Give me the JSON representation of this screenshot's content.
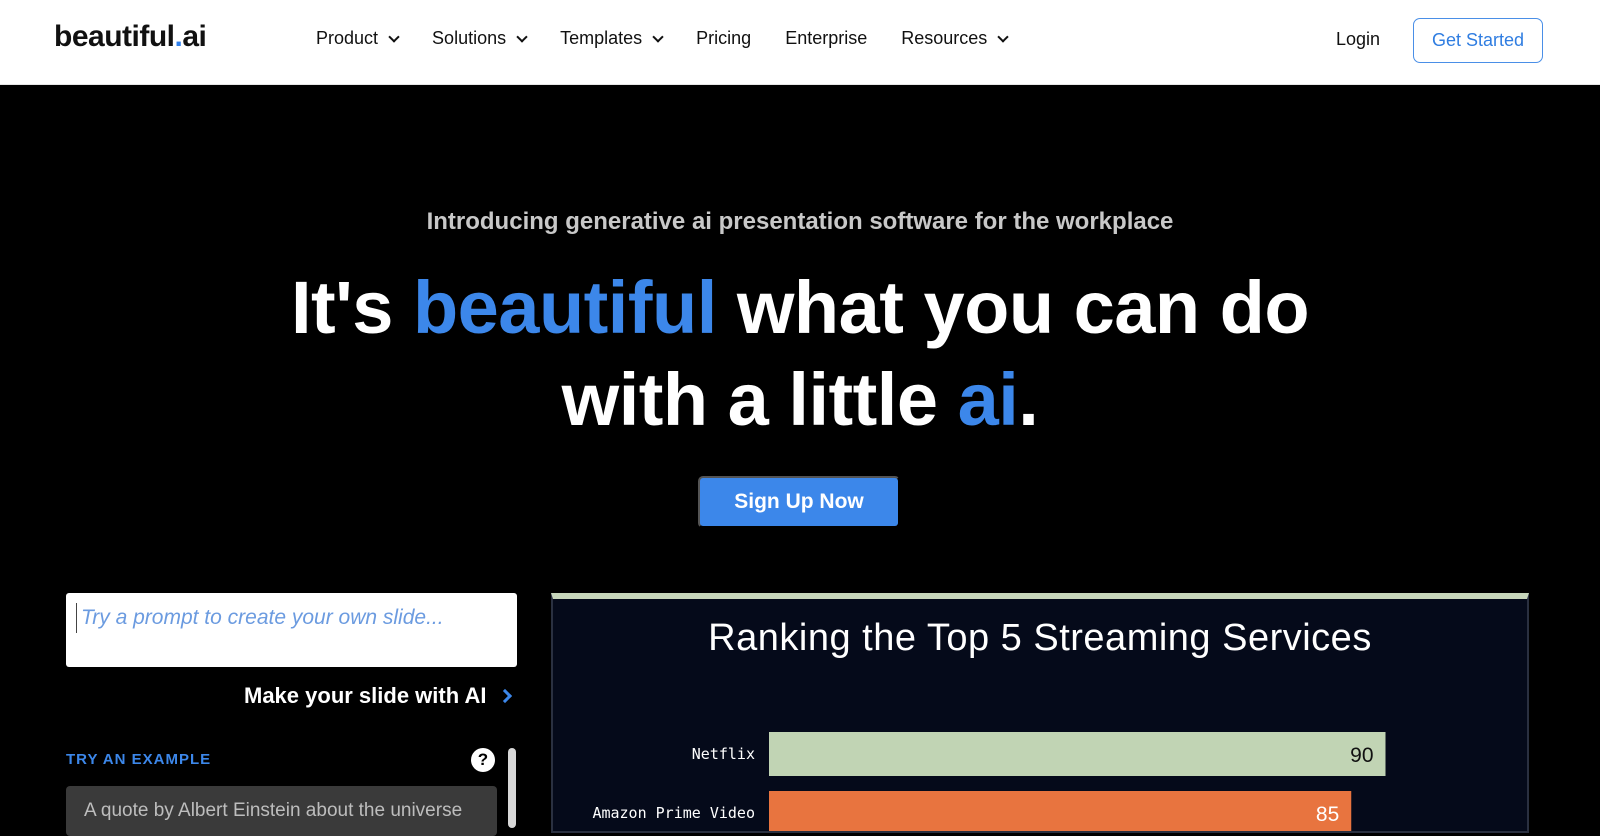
{
  "nav": {
    "logo_main": "beautiful",
    "logo_dot": ".",
    "logo_suffix": "ai",
    "items": [
      {
        "label": "Product",
        "dropdown": true
      },
      {
        "label": "Solutions",
        "dropdown": true
      },
      {
        "label": "Templates",
        "dropdown": true
      },
      {
        "label": "Pricing",
        "dropdown": false
      },
      {
        "label": "Enterprise",
        "dropdown": false
      },
      {
        "label": "Resources",
        "dropdown": true
      }
    ],
    "login": "Login",
    "get_started": "Get Started"
  },
  "hero": {
    "intro": "Introducing generative ai presentation software for the workplace",
    "headline_1": "It's ",
    "headline_blue_1": "beautiful",
    "headline_2": " what you can do",
    "headline_3": "with a little ",
    "headline_blue_2": "ai",
    "headline_4": ".",
    "signup": "Sign Up Now"
  },
  "panel": {
    "prompt_placeholder": "Try a prompt to create your own slide...",
    "make_slide": "Make your slide with AI",
    "try_example": "TRY AN EXAMPLE",
    "help": "?",
    "example_1": "A quote by Albert Einstein about the universe"
  },
  "slide": {
    "title": "Ranking the Top 5 Streaming Services"
  },
  "chart_data": {
    "type": "bar",
    "orientation": "horizontal",
    "title": "Ranking the Top 5 Streaming Services",
    "categories": [
      "Netflix",
      "Amazon Prime Video"
    ],
    "values": [
      90,
      85
    ],
    "colors": [
      "#c1d4b4",
      "#e8743f"
    ],
    "xlim": [
      0,
      100
    ]
  }
}
